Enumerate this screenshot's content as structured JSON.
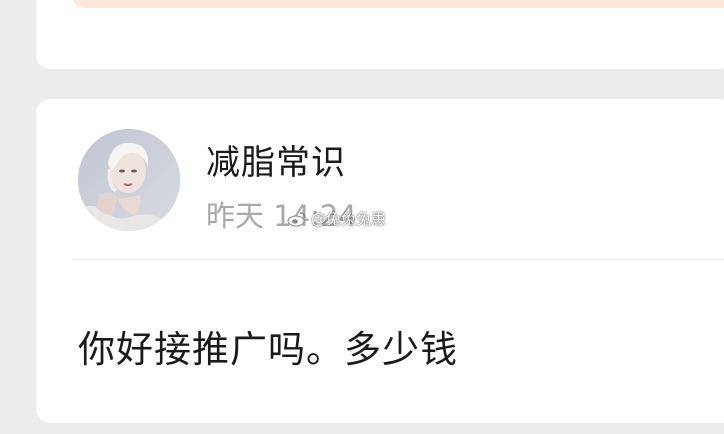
{
  "comment": {
    "author_name": "减脂常识",
    "timestamp": "昨天 14:24",
    "message": "你好接推广吗。多少钱"
  },
  "watermark": {
    "text": "@兔兔兔患",
    "icon": "weibo-logo-icon"
  },
  "colors": {
    "page_background": "#ececec",
    "card_background": "#ffffff",
    "banner_background": "#fbe9dc",
    "primary_text": "#1a1a1a",
    "secondary_text": "#a8a8a8"
  }
}
